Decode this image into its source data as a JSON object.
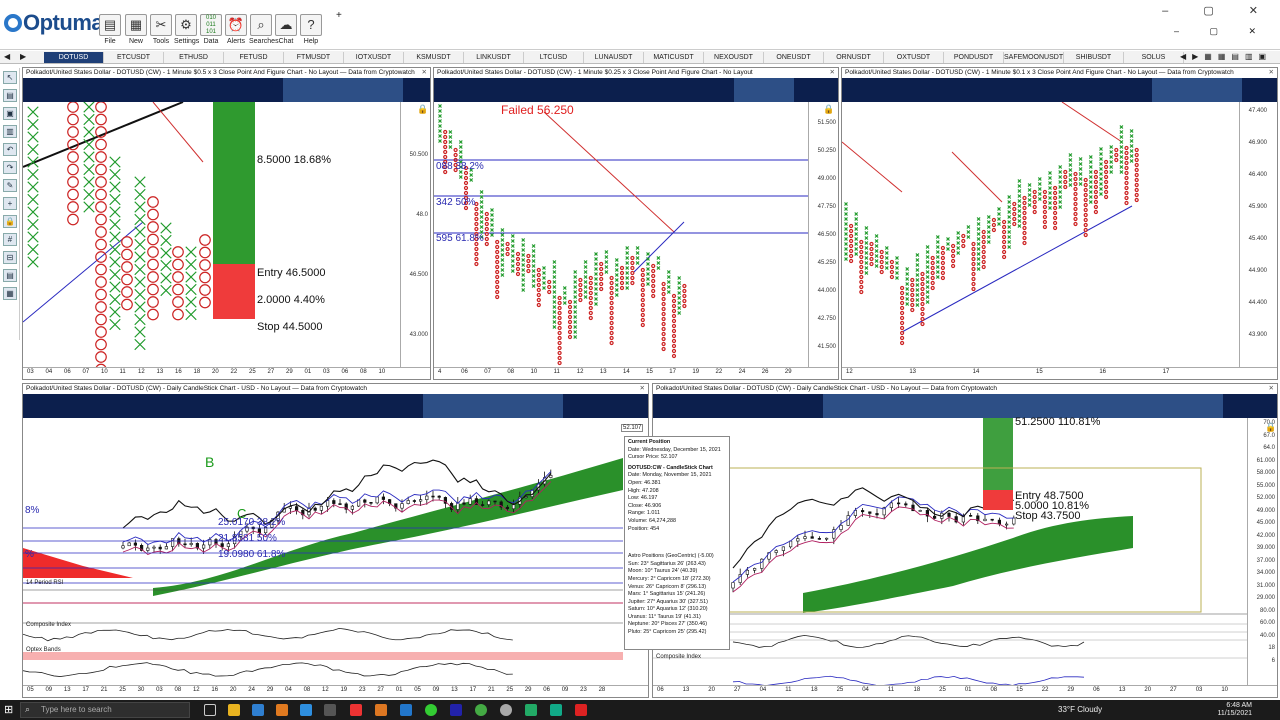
{
  "app": {
    "name": "Optuma",
    "toolbar": [
      "File",
      "New",
      "Tools",
      "Settings",
      "Data",
      "Alerts",
      "Searches",
      "Chat",
      "Help"
    ]
  },
  "symbols": [
    "DOTUSD",
    "ETCUSDT",
    "ETHUSD",
    "FETUSD",
    "FTMUSDT",
    "IOTXUSDT",
    "KSMUSDT",
    "LINKUSDT",
    "LTCUSD",
    "LUNAUSDT",
    "MATICUSDT",
    "NEXOUSDT",
    "ONEUSDT",
    "ORNUSDT",
    "OXTUSDT",
    "PONDUSDT",
    "SAFEMOONUSDT",
    "SHIBUSDT",
    "SOLUS"
  ],
  "panels": {
    "p1": {
      "title": "Polkadot/United States Dollar - DOTUSD (CW) - 1 Minute $0.5 x 3 Close Point And Figure Chart - No Layout — Data from Cryptowatch",
      "notes": {
        "target": "8.5000   18.68%",
        "entry": "Entry   46.5000",
        "risk": "2.0000   4.40%",
        "stop": "Stop   44.5000"
      },
      "yticks": [
        "50.500",
        "48.0",
        "46.500",
        "43.000"
      ],
      "xticks": [
        "03",
        "04",
        "06",
        "07",
        "10",
        "11",
        "12",
        "13",
        "16",
        "18",
        "20",
        "22",
        "25",
        "27",
        "29",
        "01",
        "03",
        "06",
        "08",
        "10"
      ],
      "months": [
        "Nov 2021",
        "Dec 2021"
      ]
    },
    "p2": {
      "title": "Polkadot/United States Dollar - DOTUSD (CW) - 1 Minute $0.25 x 3 Close Point And Figure Chart - No Layout",
      "failed": "Failed 56.250",
      "fibs": [
        "088   38.2%",
        "342   50%",
        "595   61.8%"
      ],
      "yticks": [
        "51.500",
        "50.250",
        "49.000",
        "47.750",
        "46.500",
        "45.250",
        "44.000",
        "42.750",
        "41.500"
      ],
      "xticks": [
        "4",
        "06",
        "07",
        "08",
        "10",
        "11",
        "12",
        "13",
        "14",
        "15",
        "17",
        "19",
        "22",
        "24",
        "26",
        "29"
      ],
      "months": [
        "Nov 2021"
      ]
    },
    "p3": {
      "title": "Polkadot/United States Dollar - DOTUSD (CW) - 1 Minute $0.1 x 3 Close Point And Figure Chart - No Layout — Data from Cryptowatch",
      "yticks": [
        "47.400",
        "46.900",
        "46.400",
        "45.900",
        "45.400",
        "44.900",
        "44.400",
        "43.900"
      ],
      "xticks": [
        "12",
        "13",
        "14",
        "15",
        "16",
        "17"
      ],
      "months": [
        "Nov 2021"
      ]
    },
    "p4": {
      "title": "Polkadot/United States Dollar - DOTUSD (CW) - Daily CandleStick Chart - USD - No Layout — Data from Cryptowatch",
      "fibs": [
        "8%",
        "25.0170   38.2%",
        "21.8581   50%",
        "19.0980   61.8%",
        "%"
      ],
      "labels": {
        "b": "B",
        "c": "C",
        "rsi": "14 Period RSI",
        "composite": "Composite Index",
        "optex": "Optex Bands"
      },
      "yticks": [
        "52.107"
      ],
      "xticks": [
        "05",
        "09",
        "13",
        "17",
        "21",
        "25",
        "30",
        "03",
        "08",
        "12",
        "16",
        "20",
        "24",
        "29",
        "04",
        "08",
        "12",
        "19",
        "23",
        "27",
        "01",
        "05",
        "09",
        "13",
        "17",
        "21",
        "25",
        "29",
        "06",
        "09",
        "23",
        "28"
      ],
      "months": [
        "Aug 2021",
        "Sep 2021",
        "Oct 2021",
        "Nov 2021"
      ]
    },
    "p5": {
      "title": "Polkadot/United States Dollar - DOTUSD (CW) - Daily CandleStick Chart - USD - No Layout — Data from Cryptowatch",
      "notes": {
        "target": "51.2500   110.81%",
        "entry": "Entry   48.7500",
        "risk": "5.0000   10.81%",
        "stop": "Stop   43.7500"
      },
      "labels": {
        "composite": "Composite Index"
      },
      "yticks": [
        "70.0",
        "67.0",
        "64.0",
        "61.000",
        "58.000",
        "55.000",
        "52.000",
        "49.000",
        "45.000",
        "42.000",
        "39.000",
        "37.000",
        "34.000",
        "31.000",
        "29.000",
        "80.00",
        "60.00",
        "40.00",
        "18",
        "6"
      ],
      "xticks": [
        "06",
        "13",
        "20",
        "27",
        "04",
        "11",
        "18",
        "25",
        "04",
        "11",
        "18",
        "25",
        "01",
        "08",
        "15",
        "22",
        "29",
        "06",
        "13",
        "20",
        "27",
        "03",
        "10"
      ],
      "months": [
        "Sep 2021",
        "Oct 2021",
        "Nov 2021",
        "Dec 2021",
        "Jan 20"
      ]
    }
  },
  "tooltip": {
    "current_heading": "Current Position",
    "date": "Date: Wednesday, December 15, 2021",
    "cursor": "Cursor Price: 52.107",
    "candle_heading": "DOTUSD:CW - CandleStick Chart",
    "candle_date": "Date: Monday, November 15, 2021",
    "open": "Open: 46.381",
    "high": "High: 47.208",
    "low": "Low: 46.197",
    "close": "Close: 46.906",
    "range": "Range: 1.011",
    "volume": "Volume: 64,274,288",
    "position": "Position: 454",
    "astro_heading": "Astro Positions (GeoCentric) (-5.00)",
    "astro": [
      "Sun: 23° Sagittarius 26' (263.43)",
      "Moon: 10° Taurus 24' (40.39)",
      "Mercury: 2° Capricorn 18' (272.30)",
      "Venus: 26° Capricorn 8' (296.13)",
      "Mars: 1° Sagittarius 15' (241.26)",
      "Jupiter: 27° Aquarius 30' (327.51)",
      "Saturn: 10° Aquarius 12' (310.20)",
      "Uranus: 11° Taurus 19' (41.31)",
      "Neptune: 20° Pisces 27' (350.46)",
      "Pluto: 25° Capricorn 25' (295.42)"
    ]
  },
  "taskbar": {
    "search_placeholder": "Type here to search",
    "weather": "33°F  Cloudy",
    "time": "6:48 AM",
    "date": "11/15/2021"
  },
  "colors": {
    "accent": "#1f3f77",
    "ichimoku_green": "#1f8a1f",
    "pf_x": "#1f9a2a",
    "pf_o": "#cc2222"
  }
}
